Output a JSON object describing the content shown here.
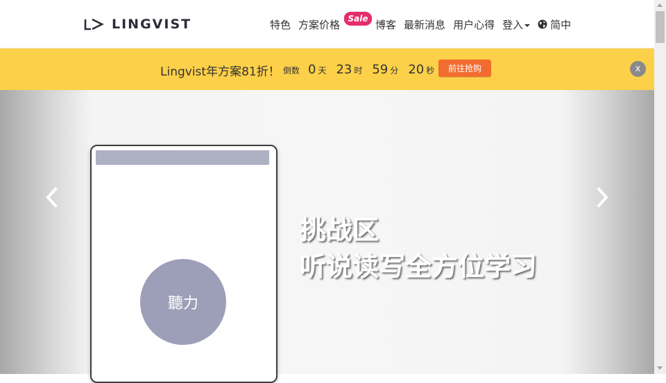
{
  "header": {
    "logo_text": "LINGVIST",
    "nav": [
      {
        "label": "特色"
      },
      {
        "label": "方案价格"
      },
      {
        "label": "博客"
      },
      {
        "label": "最新消息"
      },
      {
        "label": "用户心得"
      }
    ],
    "sale_badge": "Sale",
    "login_label": "登入",
    "language_label": "简中"
  },
  "promo": {
    "text": "Lingvist年方案81折！",
    "countdown_prefix": "倒数",
    "days": "0",
    "days_label": "天",
    "hours": "23",
    "hours_label": "时",
    "minutes": "59",
    "minutes_label": "分",
    "seconds": "20",
    "seconds_label": "秒",
    "cta_label": "前往抢购",
    "close_label": "x"
  },
  "carousel": {
    "card_label": "聽力",
    "headline_line1": "挑战区",
    "headline_line2": "听说读写全方位学习"
  },
  "colors": {
    "promo_bg": "#fdd049",
    "cta_bg": "#f26c2f",
    "sale_badge": "#e52d6a",
    "card_circle": "#9d9fb8"
  }
}
